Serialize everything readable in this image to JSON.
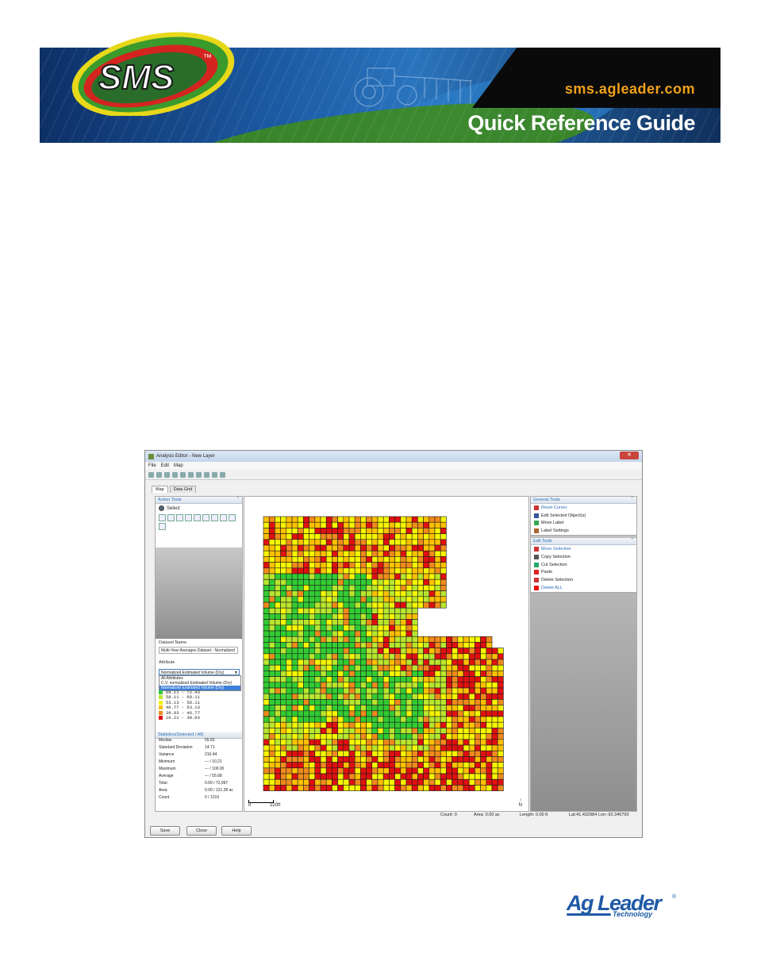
{
  "header": {
    "logo_text": "SMS",
    "trademark": "™",
    "url": "sms.agleader.com",
    "subtitle": "Quick Reference Guide"
  },
  "window": {
    "title": "Analysis Editor - New Layer",
    "close": "✕",
    "menu": [
      "File",
      "Edit",
      "Map"
    ],
    "tabs": [
      "Map",
      "Data Grid"
    ],
    "left_panel": {
      "action_tools_title": "Action Tools",
      "select_label": "Select",
      "dataset_name_label": "Dataset Name",
      "dataset_name_value": "Multi-Year Averages Dataset - Normalized",
      "attribute_label": "Attribute",
      "attribute_selected": "Normalized Estimated Volume (Dry)",
      "attribute_options": [
        "All Attributes",
        "C.V. normalized Estimated Volume (Dry)",
        "Normalized Estimated Volume (Dry)"
      ],
      "legend": [
        {
          "range": "69.11 -  72.43",
          "color": "#33cc33"
        },
        {
          "range": "58.11 -  69.11",
          "color": "#b8e62e"
        },
        {
          "range": "53.13 -  58.11",
          "color": "#f5f500"
        },
        {
          "range": "46.77 -  53.13",
          "color": "#ffc000"
        },
        {
          "range": "39.03 -  46.77",
          "color": "#f08a1c"
        },
        {
          "range": "10.21 -  39.03",
          "color": "#e01010"
        }
      ],
      "stats_title": "Statistics(Selected / All)",
      "stats": [
        {
          "key": "Median",
          "value": "55.60"
        },
        {
          "key": "Standard Deviation",
          "value": "14.71"
        },
        {
          "key": "Variance",
          "value": "216.44"
        },
        {
          "key": "Minimum",
          "value": "--- / 10.21"
        },
        {
          "key": "Maximum",
          "value": "--- / 100.00"
        },
        {
          "key": "Average",
          "value": "--- / 55.68"
        },
        {
          "key": "Total",
          "value": "0.00 / 72,997"
        },
        {
          "key": "Area",
          "value": "0.00 / 121.28 ac"
        },
        {
          "key": "Count",
          "value": "0 / 1319"
        }
      ]
    },
    "map": {
      "scale_start": "0",
      "scale_end": "220ft",
      "north": "N"
    },
    "right_panel": {
      "general_title": "General Tools",
      "general_items": [
        "Reset Cursor",
        "Edit Selected Object(s)",
        "Move Label",
        "Label Settings"
      ],
      "edit_title": "Edit Tools",
      "edit_items": [
        "Move Selection",
        "Copy Selection",
        "Cut Selection",
        "Paste",
        "Delete Selection",
        "Delete ALL"
      ]
    },
    "status": {
      "count": "Count: 0",
      "area": "Area: 0.00 ac",
      "length": "Length: 0.00 ft",
      "lat": "Lat:41.432984",
      "lon": "Lon:-92.340793"
    },
    "buttons": {
      "save": "Save",
      "close": "Close",
      "help": "Help"
    }
  },
  "footer_logo": {
    "name": "Ag Leader",
    "reg": "®",
    "tagline": "Technology"
  }
}
